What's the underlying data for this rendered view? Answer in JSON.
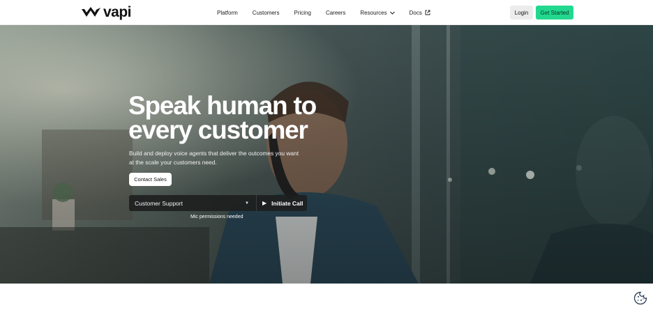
{
  "brand": {
    "name": "vapi",
    "logo_icon": "vapi-mark-icon"
  },
  "nav": {
    "links": [
      {
        "label": "Platform"
      },
      {
        "label": "Customers"
      },
      {
        "label": "Pricing"
      },
      {
        "label": "Careers"
      },
      {
        "label": "Resources",
        "icon": "chevron-down-icon"
      },
      {
        "label": "Docs",
        "icon": "external-link-icon"
      }
    ],
    "login_label": "Login",
    "cta_label": "Get Started"
  },
  "hero": {
    "title_line1": "Speak human to",
    "title_line2": "every customer",
    "subtitle": "Build and deploy voice agents that deliver the outcomes you want at the scale your customers need.",
    "contact_label": "Contact Sales",
    "select_value": "Customer Support",
    "initiate_label": "Initiate Call",
    "mic_note": "Mic permissions needed"
  },
  "cookie_icon": "cookie-icon",
  "colors": {
    "accent": "#22d88f",
    "text": "#111111"
  }
}
